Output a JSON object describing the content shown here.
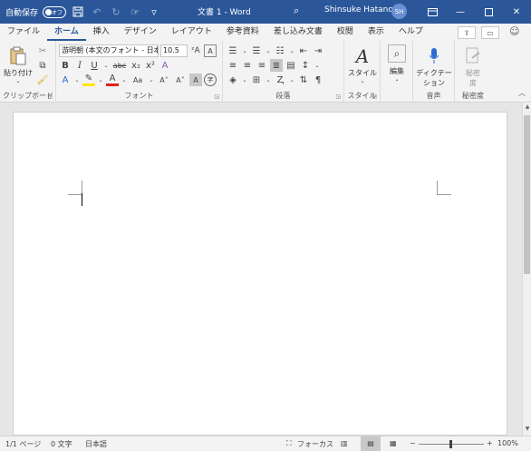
{
  "titlebar": {
    "autosave_label": "自動保存",
    "autosave_state": "オフ",
    "document_title": "文書 1  -  Word",
    "user_name": "Shinsuke Hatano",
    "user_initials": "SH",
    "background_color": "#2b579a"
  },
  "tabs": [
    "ファイル",
    "ホーム",
    "挿入",
    "デザイン",
    "レイアウト",
    "参考資料",
    "差し込み文書",
    "校閲",
    "表示",
    "ヘルプ"
  ],
  "active_tab": "ホーム",
  "ribbon": {
    "clipboard": {
      "label": "クリップボード",
      "paste_label": "貼り付け"
    },
    "font": {
      "label": "フォント",
      "font_name": "游明朝 (本文のフォント - 日本",
      "font_size": "10.5",
      "bold": "B",
      "italic": "I",
      "underline": "U",
      "strikethrough": "abc",
      "subscript": "x₂",
      "superscript": "x²",
      "change_case": "Aa",
      "grow_font": "A˄",
      "shrink_font": "A˅"
    },
    "paragraph": {
      "label": "段落"
    },
    "styles": {
      "label": "スタイル",
      "button_label": "スタイル"
    },
    "editing": {
      "button_label": "編集"
    },
    "voice": {
      "label": "音声",
      "dictate_label": "ディクテー\nション"
    },
    "sensitivity": {
      "label": "秘密度",
      "button_label": "秘密\n度"
    }
  },
  "statusbar": {
    "page": "1/1 ページ",
    "words": "0 文字",
    "language": "日本語",
    "focus": "フォーカス",
    "zoom_minus": "−",
    "zoom_plus": "+",
    "zoom_level": "100%"
  }
}
